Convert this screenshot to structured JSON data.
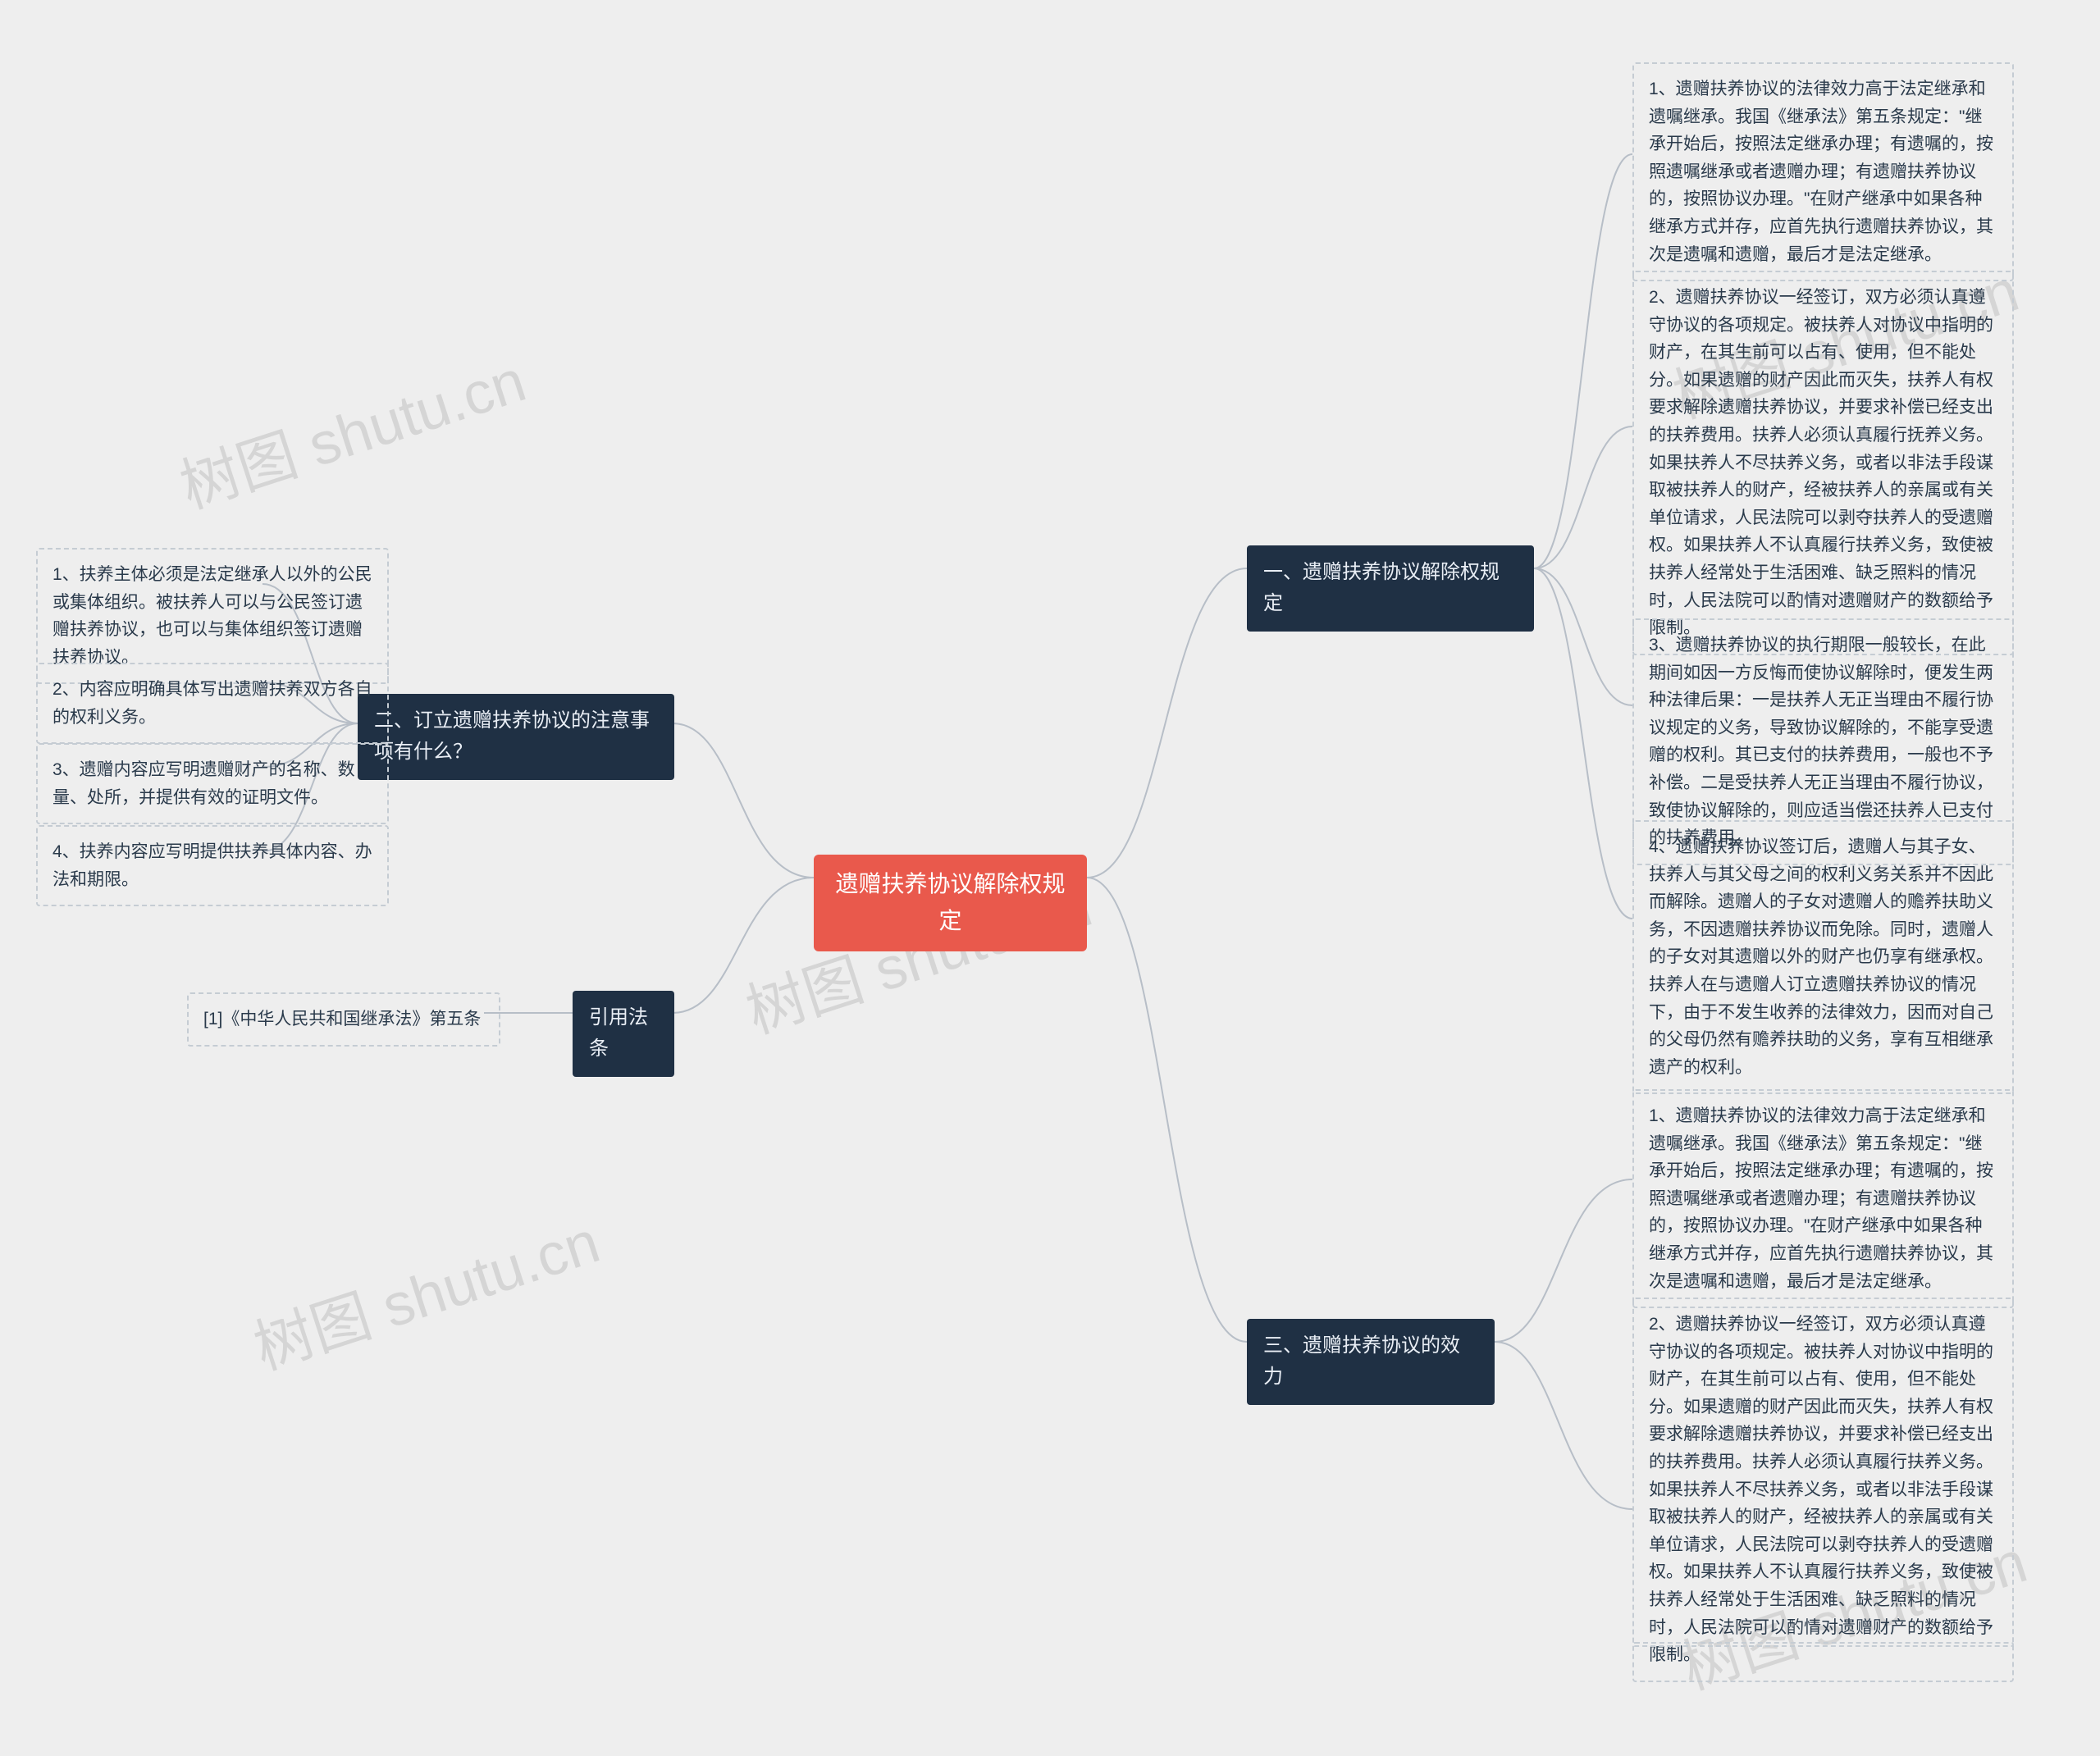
{
  "chart_data": {
    "type": "mindmap",
    "center": "遗赠扶养协议解除权规定",
    "branches": [
      {
        "label": "一、遗赠扶养协议解除权规定",
        "side": "right",
        "children": [
          "1、遗赠扶养协议的法律效力高于法定继承和遗嘱继承。我国《继承法》第五条规定：\"继承开始后，按照法定继承办理；有遗嘱的，按照遗嘱继承或者遗赠办理；有遗赠扶养协议的，按照协议办理。\"在财产继承中如果各种继承方式并存，应首先执行遗赠扶养协议，其次是遗嘱和遗赠，最后才是法定继承。",
          "2、遗赠扶养协议一经签订，双方必须认真遵守协议的各项规定。被扶养人对协议中指明的财产，在其生前可以占有、使用，但不能处分。如果遗赠的财产因此而灭失，扶养人有权要求解除遗赠扶养协议，并要求补偿已经支出的扶养费用。扶养人必须认真履行抚养义务。如果扶养人不尽扶养义务，或者以非法手段谋取被扶养人的财产，经被扶养人的亲属或有关单位请求，人民法院可以剥夺扶养人的受遗赠权。如果扶养人不认真履行扶养义务，致使被扶养人经常处于生活困难、缺乏照料的情况时，人民法院可以酌情对遗赠财产的数额给予限制。",
          "3、遗赠扶养协议的执行期限一般较长，在此期间如因一方反悔而使协议解除时，便发生两种法律后果：一是扶养人无正当理由不履行协议规定的义务，导致协议解除的，不能享受遗赠的权利。其已支付的扶养费用，一般也不予补偿。二是受扶养人无正当理由不履行协议，致使协议解除的，则应适当偿还扶养人已支付的扶养费用。",
          "4、遗赠扶养协议签订后，遗赠人与其子女、扶养人与其父母之间的权利义务关系并不因此而解除。遗赠人的子女对遗赠人的赡养扶助义务，不因遗赠扶养协议而免除。同时，遗赠人的子女对其遗赠以外的财产也仍享有继承权。扶养人在与遗赠人订立遗赠扶养协议的情况下，由于不发生收养的法律效力，因而对自己的父母仍然有赡养扶助的义务，享有互相继承遗产的权利。"
        ]
      },
      {
        "label": "三、遗赠扶养协议的效力",
        "side": "right",
        "children": [
          "1、遗赠扶养协议的法律效力高于法定继承和遗嘱继承。我国《继承法》第五条规定：\"继承开始后，按照法定继承办理；有遗嘱的，按照遗嘱继承或者遗赠办理；有遗赠扶养协议的，按照协议办理。\"在财产继承中如果各种继承方式并存，应首先执行遗赠扶养协议，其次是遗嘱和遗赠，最后才是法定继承。",
          "2、遗赠扶养协议一经签订，双方必须认真遵守协议的各项规定。被扶养人对协议中指明的财产，在其生前可以占有、使用，但不能处分。如果遗赠的财产因此而灭失，扶养人有权要求解除遗赠扶养协议，并要求补偿已经支出的扶养费用。扶养人必须认真履行扶养义务。如果扶养人不尽扶养义务，或者以非法手段谋取被扶养人的财产，经被扶养人的亲属或有关单位请求，人民法院可以剥夺扶养人的受遗赠权。如果扶养人不认真履行扶养义务，致使被扶养人经常处于生活困难、缺乏照料的情况时，人民法院可以酌情对遗赠财产的数额给予限制。"
        ]
      },
      {
        "label": "二、订立遗赠扶养协议的注意事项有什么？",
        "side": "left",
        "children": [
          "1、扶养主体必须是法定继承人以外的公民或集体组织。被扶养人可以与公民签订遗赠扶养协议，也可以与集体组织签订遗赠扶养协议。",
          "2、内容应明确具体写出遗赠扶养双方各自的权利义务。",
          "3、遗赠内容应写明遗赠财产的名称、数量、处所，并提供有效的证明文件。",
          "4、扶养内容应写明提供扶养具体内容、办法和期限。"
        ]
      },
      {
        "label": "引用法条",
        "side": "left",
        "children": [
          "[1]《中华人民共和国继承法》第五条"
        ]
      }
    ]
  },
  "center": {
    "title": "遗赠扶养协议解除权规定"
  },
  "branch1": {
    "label": "一、遗赠扶养协议解除权规定"
  },
  "branch3_effect": {
    "label": "三、遗赠扶养协议的效力"
  },
  "branch2": {
    "label": "二、订立遗赠扶养协议的注意事项有什么？"
  },
  "branch_law": {
    "label": "引用法条"
  },
  "b1": {
    "i1": "1、遗赠扶养协议的法律效力高于法定继承和遗嘱继承。我国《继承法》第五条规定：\"继承开始后，按照法定继承办理；有遗嘱的，按照遗嘱继承或者遗赠办理；有遗赠扶养协议的，按照协议办理。\"在财产继承中如果各种继承方式并存，应首先执行遗赠扶养协议，其次是遗嘱和遗赠，最后才是法定继承。",
    "i2": "2、遗赠扶养协议一经签订，双方必须认真遵守协议的各项规定。被扶养人对协议中指明的财产，在其生前可以占有、使用，但不能处分。如果遗赠的财产因此而灭失，扶养人有权要求解除遗赠扶养协议，并要求补偿已经支出的扶养费用。扶养人必须认真履行抚养义务。如果扶养人不尽扶养义务，或者以非法手段谋取被扶养人的财产，经被扶养人的亲属或有关单位请求，人民法院可以剥夺扶养人的受遗赠权。如果扶养人不认真履行扶养义务，致使被扶养人经常处于生活困难、缺乏照料的情况时，人民法院可以酌情对遗赠财产的数额给予限制。",
    "i3": "3、遗赠扶养协议的执行期限一般较长，在此期间如因一方反悔而使协议解除时，便发生两种法律后果：一是扶养人无正当理由不履行协议规定的义务，导致协议解除的，不能享受遗赠的权利。其已支付的扶养费用，一般也不予补偿。二是受扶养人无正当理由不履行协议，致使协议解除的，则应适当偿还扶养人已支付的扶养费用。",
    "i4": "4、遗赠扶养协议签订后，遗赠人与其子女、扶养人与其父母之间的权利义务关系并不因此而解除。遗赠人的子女对遗赠人的赡养扶助义务，不因遗赠扶养协议而免除。同时，遗赠人的子女对其遗赠以外的财产也仍享有继承权。扶养人在与遗赠人订立遗赠扶养协议的情况下，由于不发生收养的法律效力，因而对自己的父母仍然有赡养扶助的义务，享有互相继承遗产的权利。"
  },
  "b3e": {
    "i1": "1、遗赠扶养协议的法律效力高于法定继承和遗嘱继承。我国《继承法》第五条规定：\"继承开始后，按照法定继承办理；有遗嘱的，按照遗嘱继承或者遗赠办理；有遗赠扶养协议的，按照协议办理。\"在财产继承中如果各种继承方式并存，应首先执行遗赠扶养协议，其次是遗嘱和遗赠，最后才是法定继承。",
    "i2": "2、遗赠扶养协议一经签订，双方必须认真遵守协议的各项规定。被扶养人对协议中指明的财产，在其生前可以占有、使用，但不能处分。如果遗赠的财产因此而灭失，扶养人有权要求解除遗赠扶养协议，并要求补偿已经支出的扶养费用。扶养人必须认真履行扶养义务。如果扶养人不尽扶养义务，或者以非法手段谋取被扶养人的财产，经被扶养人的亲属或有关单位请求，人民法院可以剥夺扶养人的受遗赠权。如果扶养人不认真履行扶养义务，致使被扶养人经常处于生活困难、缺乏照料的情况时，人民法院可以酌情对遗赠财产的数额给予限制。"
  },
  "b2": {
    "i1": "1、扶养主体必须是法定继承人以外的公民或集体组织。被扶养人可以与公民签订遗赠扶养协议，也可以与集体组织签订遗赠扶养协议。",
    "i2": "2、内容应明确具体写出遗赠扶养双方各自的权利义务。",
    "i3": "3、遗赠内容应写明遗赠财产的名称、数量、处所，并提供有效的证明文件。",
    "i4": "4、扶养内容应写明提供扶养具体内容、办法和期限。"
  },
  "blaw": {
    "i1": "[1]《中华人民共和国继承法》第五条"
  },
  "watermark": "树图 shutu.cn"
}
